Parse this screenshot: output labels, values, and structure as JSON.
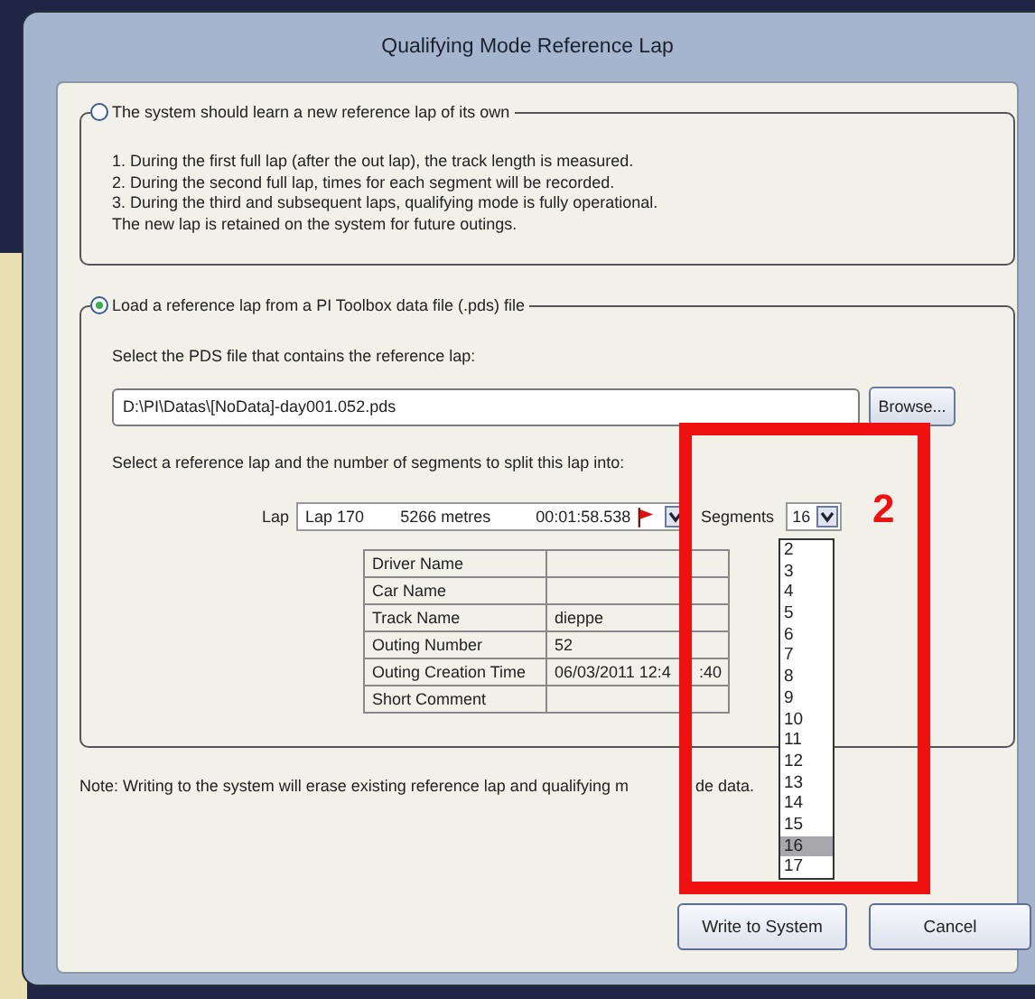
{
  "window": {
    "title": "Qualifying Mode Reference Lap"
  },
  "options": [
    {
      "label": "The system should learn a new reference lap of its own",
      "selected": false
    },
    {
      "label": "Load a reference lap from a PI Toolbox data file (.pds) file",
      "selected": true
    }
  ],
  "learn_steps": [
    "1. During the first full lap (after the out lap), the track length is measured.",
    "2. During the second full lap, times for each segment will be recorded.",
    "3. During the third and subsequent laps, qualifying mode is fully operational.",
    "The new lap is retained on the system for future outings."
  ],
  "pds_prompt": "Select the PDS file that contains the reference lap:",
  "pds_file": {
    "value": "D:\\PI\\Datas\\[NoData]-day001.052.pds"
  },
  "browse_button": "Browse...",
  "segments_prompt": "Select a reference lap and the number of segments to split this lap into:",
  "lap": {
    "label": "Lap",
    "lap": "Lap 170",
    "length": "5266 metres",
    "time": "00:01:58.538"
  },
  "segments": {
    "label": "Segments",
    "value": "16",
    "expanded": true,
    "options": [
      {
        "label": "2",
        "selected": false
      },
      {
        "label": "3",
        "selected": false
      },
      {
        "label": "4",
        "selected": false
      },
      {
        "label": "5",
        "selected": false
      },
      {
        "label": "6",
        "selected": false
      },
      {
        "label": "7",
        "selected": false
      },
      {
        "label": "8",
        "selected": false
      },
      {
        "label": "9",
        "selected": false
      },
      {
        "label": "10",
        "selected": false
      },
      {
        "label": "11",
        "selected": false
      },
      {
        "label": "12",
        "selected": false
      },
      {
        "label": "13",
        "selected": false
      },
      {
        "label": "14",
        "selected": false
      },
      {
        "label": "15",
        "selected": false
      },
      {
        "label": "16",
        "selected": true
      },
      {
        "label": "17",
        "selected": false
      }
    ]
  },
  "lap_info": [
    {
      "name": "Driver Name"
    },
    {
      "name": "Car Name"
    },
    {
      "name": "Track Name",
      "value": "dieppe"
    },
    {
      "name": "Outing Number",
      "value": "52"
    },
    {
      "name": "Outing Creation Time",
      "value": "06/03/2011 12:4",
      "value_after": ":40"
    },
    {
      "name": "Short Comment"
    }
  ],
  "note": "Note: Writing to the system will erase existing reference lap and qualifying m",
  "note_after": "de data.",
  "buttons": [
    "Write to System",
    "Cancel"
  ],
  "annotation": {
    "label": "2"
  }
}
